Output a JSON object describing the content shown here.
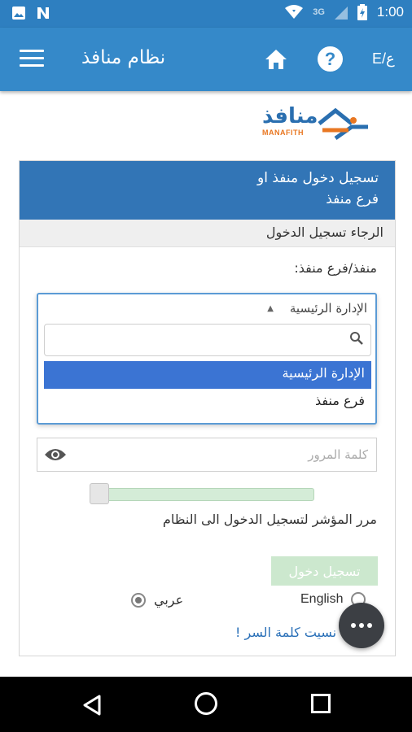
{
  "status_bar": {
    "time": "1:00",
    "network": "3G"
  },
  "app_bar": {
    "title": "نظام منافذ",
    "language_toggle": "E/ع",
    "help_label": "?"
  },
  "logo": {
    "arabic": "منافذ",
    "english": "MANAFITH"
  },
  "card": {
    "header_line1": "تسجيل دخول منفذ او",
    "header_line2": "فرع منفذ",
    "subheader": "الرجاء تسجيل الدخول",
    "field_label": "منفذ/فرع منفذ:"
  },
  "dropdown": {
    "selected": "الإدارة الرئيسية",
    "options": [
      "الإدارة الرئيسية",
      "فرع منفذ"
    ]
  },
  "password": {
    "placeholder": "كلمة المرور"
  },
  "slider": {
    "caption": "مرر المؤشر لتسجيل الدخول الى النظام",
    "value_percent": 0
  },
  "login_button": "تسجيل دخول",
  "language": {
    "arabic": "عربي",
    "english": "English",
    "selected": "arabic"
  },
  "forgot_link": "نسيت كلمة السر !"
}
